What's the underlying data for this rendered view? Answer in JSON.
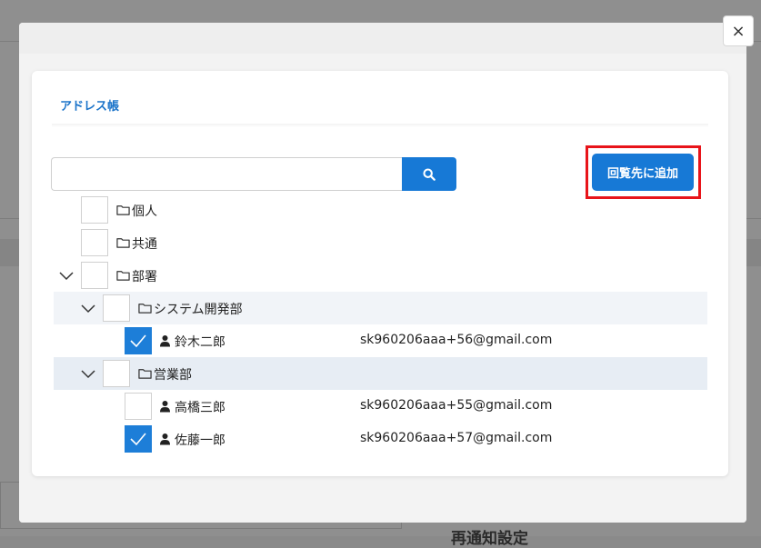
{
  "modal": {
    "title": "アドレス帳",
    "close_label": "×",
    "search": {
      "value": "",
      "placeholder": ""
    },
    "add_button_label": "回覧先に追加"
  },
  "tree": {
    "personal": {
      "label": "個人",
      "checked": false
    },
    "shared": {
      "label": "共通",
      "checked": false
    },
    "departments": {
      "label": "部署",
      "expanded": true,
      "system_dev": {
        "label": "システム開発部",
        "expanded": true,
        "members": [
          {
            "name": "鈴木二郎",
            "email": "sk960206aaa+56@gmail.com",
            "checked": true
          }
        ]
      },
      "sales": {
        "label": "営業部",
        "expanded": true,
        "members": [
          {
            "name": "高橋三郎",
            "email": "sk960206aaa+55@gmail.com",
            "checked": false
          },
          {
            "name": "佐藤一郎",
            "email": "sk960206aaa+57@gmail.com",
            "checked": true
          }
        ]
      }
    }
  },
  "background": {
    "heading": "再通知設定"
  },
  "colors": {
    "primary": "#1779d6",
    "highlight": "#e8141a",
    "title": "#1a73c9"
  }
}
